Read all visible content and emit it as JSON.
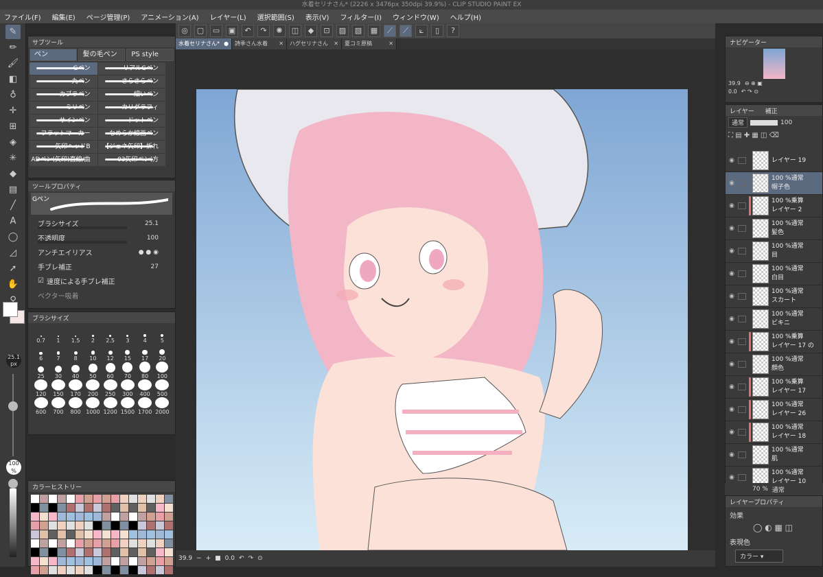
{
  "window": {
    "title": "水着セリナさん* (2226 x 3476px 350dpi 39.9%) - CLIP STUDIO PAINT EX"
  },
  "menu": [
    "ファイル(F)",
    "編集(E)",
    "ページ管理(P)",
    "アニメーション(A)",
    "レイヤー(L)",
    "選択範囲(S)",
    "表示(V)",
    "フィルター(I)",
    "ウィンドウ(W)",
    "ヘルプ(H)"
  ],
  "subtool": {
    "header": "サブツール",
    "tabs": [
      "ペン",
      "髪の毛ペン",
      "PS style"
    ],
    "brushes": [
      "Gペン",
      "リアルGペン",
      "丸ペン",
      "さらさらペン",
      "カブラペン",
      "細いペン",
      "ミリペン",
      "カリグラフィ",
      "サインペン",
      "ドットペン",
      "フラットマーカー",
      "なめらか線画ペン",
      "矢印ヘッドB",
      "【ジェネ矢印】折れ線",
      "ADぺン(矢印)直線/曲",
      "03矢印ペン(方"
    ]
  },
  "toolprop": {
    "header": "ツールプロパティ",
    "preview_label": "Gペン",
    "brush_size_label": "ブラシサイズ",
    "brush_size_value": "25.1",
    "opacity_label": "不透明度",
    "opacity_value": "100",
    "antialias_label": "アンチエイリアス",
    "stabilize_label": "手ブレ補正",
    "stabilize_value": "27",
    "speed_label": "速度による手ブレ補正",
    "vector_label": "ベクター吸着"
  },
  "brushsize": {
    "header": "ブラシサイズ",
    "sizes": [
      "0.7",
      "1",
      "1.5",
      "2",
      "2.5",
      "3",
      "4",
      "5",
      "6",
      "7",
      "8",
      "10",
      "12",
      "15",
      "17",
      "20",
      "25",
      "30",
      "40",
      "50",
      "60",
      "70",
      "80",
      "100",
      "120",
      "150",
      "170",
      "200",
      "250",
      "300",
      "400",
      "500",
      "600",
      "700",
      "800",
      "1000",
      "1200",
      "1500",
      "1700",
      "2000"
    ]
  },
  "colorhistory": {
    "header": "カラーヒストリー"
  },
  "leftstrip": {
    "size_value": "25.1",
    "size_unit": "px",
    "opacity_value": "100",
    "opacity_unit": "%"
  },
  "doctabs": [
    "水着セリナさん*",
    "詩季さん水着",
    "ハグセリナさん",
    "夏コミ原稿"
  ],
  "status": {
    "zoom": "39.9",
    "angle": "0.0"
  },
  "navigator": {
    "header": "ナビゲーター",
    "zoom": "39.9",
    "angle": "0.0"
  },
  "layerpanel": {
    "header": "レイヤー",
    "tab2": "補正",
    "blend": "通常",
    "opacity": "100",
    "layers": [
      {
        "pct": "",
        "mode": "",
        "name": "レイヤー 19",
        "clip": false,
        "sel": false
      },
      {
        "pct": "100 %",
        "mode": "通常",
        "name": "帽子色",
        "clip": false,
        "sel": true
      },
      {
        "pct": "100 %",
        "mode": "乗算",
        "name": "レイヤー 2",
        "clip": true,
        "sel": false
      },
      {
        "pct": "100 %",
        "mode": "通常",
        "name": "髪色",
        "clip": false,
        "sel": false
      },
      {
        "pct": "100 %",
        "mode": "通常",
        "name": "目",
        "clip": false,
        "sel": false
      },
      {
        "pct": "100 %",
        "mode": "通常",
        "name": "白目",
        "clip": false,
        "sel": false
      },
      {
        "pct": "100 %",
        "mode": "通常",
        "name": "スカート",
        "clip": false,
        "sel": false
      },
      {
        "pct": "100 %",
        "mode": "通常",
        "name": "ビキニ",
        "clip": false,
        "sel": false
      },
      {
        "pct": "100 %",
        "mode": "乗算",
        "name": "レイヤー 17 の",
        "clip": true,
        "sel": false
      },
      {
        "pct": "100 %",
        "mode": "通常",
        "name": "顔色",
        "clip": false,
        "sel": false
      },
      {
        "pct": "100 %",
        "mode": "乗算",
        "name": "レイヤー 17",
        "clip": true,
        "sel": false
      },
      {
        "pct": "100 %",
        "mode": "通常",
        "name": "レイヤー 26",
        "clip": true,
        "sel": false
      },
      {
        "pct": "100 %",
        "mode": "通常",
        "name": "レイヤー 18",
        "clip": true,
        "sel": false
      },
      {
        "pct": "100 %",
        "mode": "通常",
        "name": "肌",
        "clip": false,
        "sel": false
      },
      {
        "pct": "100 %",
        "mode": "通常",
        "name": "レイヤー 10",
        "clip": false,
        "sel": false
      }
    ],
    "footer_pct": "70 %",
    "footer_mode": "通常"
  },
  "layerprop": {
    "header": "レイヤープロパティ",
    "effect_label": "効果",
    "expression_label": "表現色",
    "expression_value": "カラー"
  },
  "colors": {
    "accent": "#5c6a80",
    "sky_top": "#7fa6d4",
    "sky_bottom": "#d8ecf7",
    "hair": "#f2b6c6",
    "skin": "#fbe1d8",
    "hat": "#e8e8ee",
    "clip_red": "#e07070"
  }
}
